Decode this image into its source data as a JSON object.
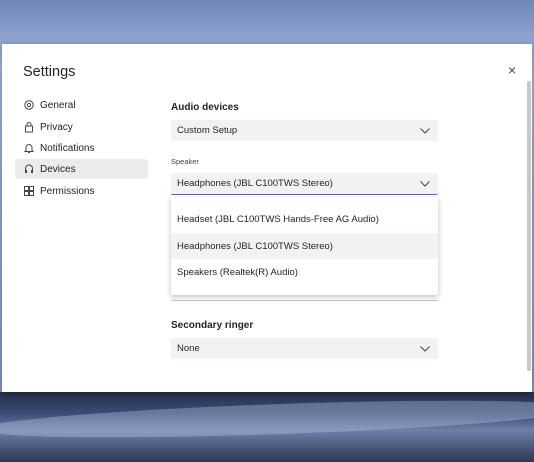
{
  "dialog": {
    "title": "Settings",
    "close_label": "×"
  },
  "sidebar": {
    "items": [
      {
        "label": "General",
        "icon": "gear-icon"
      },
      {
        "label": "Privacy",
        "icon": "lock-icon"
      },
      {
        "label": "Notifications",
        "icon": "bell-icon"
      },
      {
        "label": "Devices",
        "icon": "headset-icon",
        "selected": true
      },
      {
        "label": "Permissions",
        "icon": "apps-icon"
      }
    ]
  },
  "main": {
    "audio_devices_heading": "Audio devices",
    "audio_devices_value": "Custom Setup",
    "speaker_label": "Speaker",
    "speaker_value": "Headphones (JBL C100TWS Stereo)",
    "speaker_options": [
      "Headset (JBL C100TWS Hands-Free AG Audio)",
      "Headphones (JBL C100TWS Stereo)",
      "Speakers (Realtek(R) Audio)"
    ],
    "speaker_selected_index": 1,
    "secondary_ringer_heading": "Secondary ringer",
    "secondary_ringer_value": "None"
  },
  "colors": {
    "accent": "#6264a7",
    "selected_bg": "#edebe9",
    "field_bg": "#f3f2f1"
  }
}
